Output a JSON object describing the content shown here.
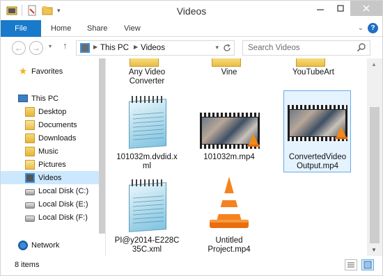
{
  "window": {
    "title": "Videos"
  },
  "ribbon": {
    "tabs": [
      {
        "label": "File"
      },
      {
        "label": "Home"
      },
      {
        "label": "Share"
      },
      {
        "label": "View"
      }
    ],
    "help_label": "?"
  },
  "address": {
    "crumbs": [
      "This PC",
      "Videos"
    ]
  },
  "search": {
    "placeholder": "Search Videos"
  },
  "nav": {
    "favorites": "Favorites",
    "this_pc": "This PC",
    "items": [
      {
        "label": "Desktop",
        "icon": "folder-icon"
      },
      {
        "label": "Documents",
        "icon": "documents-folder-icon"
      },
      {
        "label": "Downloads",
        "icon": "downloads-folder-icon"
      },
      {
        "label": "Music",
        "icon": "music-folder-icon"
      },
      {
        "label": "Pictures",
        "icon": "pictures-folder-icon"
      },
      {
        "label": "Videos",
        "icon": "videos-folder-icon",
        "selected": true
      },
      {
        "label": "Local Disk (C:)",
        "icon": "drive-icon"
      },
      {
        "label": "Local Disk (E:)",
        "icon": "drive-icon"
      },
      {
        "label": "Local Disk (F:)",
        "icon": "drive-icon"
      }
    ],
    "network": "Network"
  },
  "files": [
    {
      "name": "Any Video Converter",
      "type": "folder"
    },
    {
      "name": "Vine",
      "type": "folder"
    },
    {
      "name": "YouTubeArt",
      "type": "folder"
    },
    {
      "name": "101032m.dvdid.xml",
      "type": "xml"
    },
    {
      "name": "101032m.mp4",
      "type": "video"
    },
    {
      "name": "ConvertedVideoOutput.mp4",
      "type": "video",
      "selected": true
    },
    {
      "name": "PI@y2014-E228C35C.xml",
      "type": "xml"
    },
    {
      "name": "Untitled Project.mp4",
      "type": "vlc"
    }
  ],
  "labels": {
    "f0": "Any Video\nConverter",
    "f1": "Vine",
    "f2": "YouTubeArt",
    "f3": "101032m.dvdid.x\nml",
    "f4": "101032m.mp4",
    "f5": "ConvertedVideo\nOutput.mp4",
    "f6": "PI@y2014-E228C\n35C.xml",
    "f7": "Untitled\nProject.mp4"
  },
  "status": {
    "item_count": "8 items"
  },
  "colors": {
    "accent": "#1979ca",
    "selection": "#cce8ff",
    "selection_border": "#66a7e8"
  }
}
